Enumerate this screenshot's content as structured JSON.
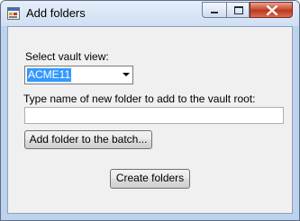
{
  "window": {
    "title": "Add folders",
    "icon": "app-window-icon",
    "controls": {
      "minimize_icon": "minimize-icon",
      "maximize_icon": "maximize-icon",
      "close_icon": "close-icon"
    }
  },
  "form": {
    "vault_view_label": "Select vault view:",
    "vault_view_value": "ACME11",
    "new_folder_label": "Type name of new folder to add to the vault root:",
    "new_folder_value": "",
    "add_to_batch_label": "Add folder to the batch...",
    "create_folders_label": "Create folders"
  },
  "colors": {
    "selection_highlight": "#3399ff",
    "close_button": "#c8452e",
    "dialog_background": "#f0f0f0"
  }
}
